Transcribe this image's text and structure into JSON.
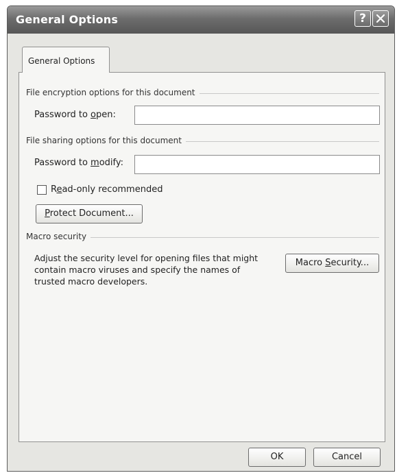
{
  "window": {
    "title": "General Options",
    "help_icon_glyph": "?",
    "close_icon": "close-icon"
  },
  "tabs": [
    {
      "label": "General Options"
    }
  ],
  "encryption": {
    "group_label": "File encryption options for this document",
    "password_open_pre": "Password to ",
    "password_open_accel": "o",
    "password_open_post": "pen:",
    "password_open_value": ""
  },
  "sharing": {
    "group_label": "File sharing options for this document",
    "password_modify_pre": "Password to ",
    "password_modify_accel": "m",
    "password_modify_post": "odify:",
    "password_modify_value": "",
    "readonly_pre": "R",
    "readonly_accel": "e",
    "readonly_post": "ad-only recommended",
    "readonly_checked": false,
    "protect_accel": "P",
    "protect_post": "rotect Document..."
  },
  "macro": {
    "group_label": "Macro security",
    "description": "Adjust the security level for opening files that might\ncontain macro viruses and specify the names of\ntrusted macro developers.",
    "button_pre": "Macro ",
    "button_accel": "S",
    "button_post": "ecurity..."
  },
  "footer": {
    "ok_label": "OK",
    "cancel_label": "Cancel"
  }
}
